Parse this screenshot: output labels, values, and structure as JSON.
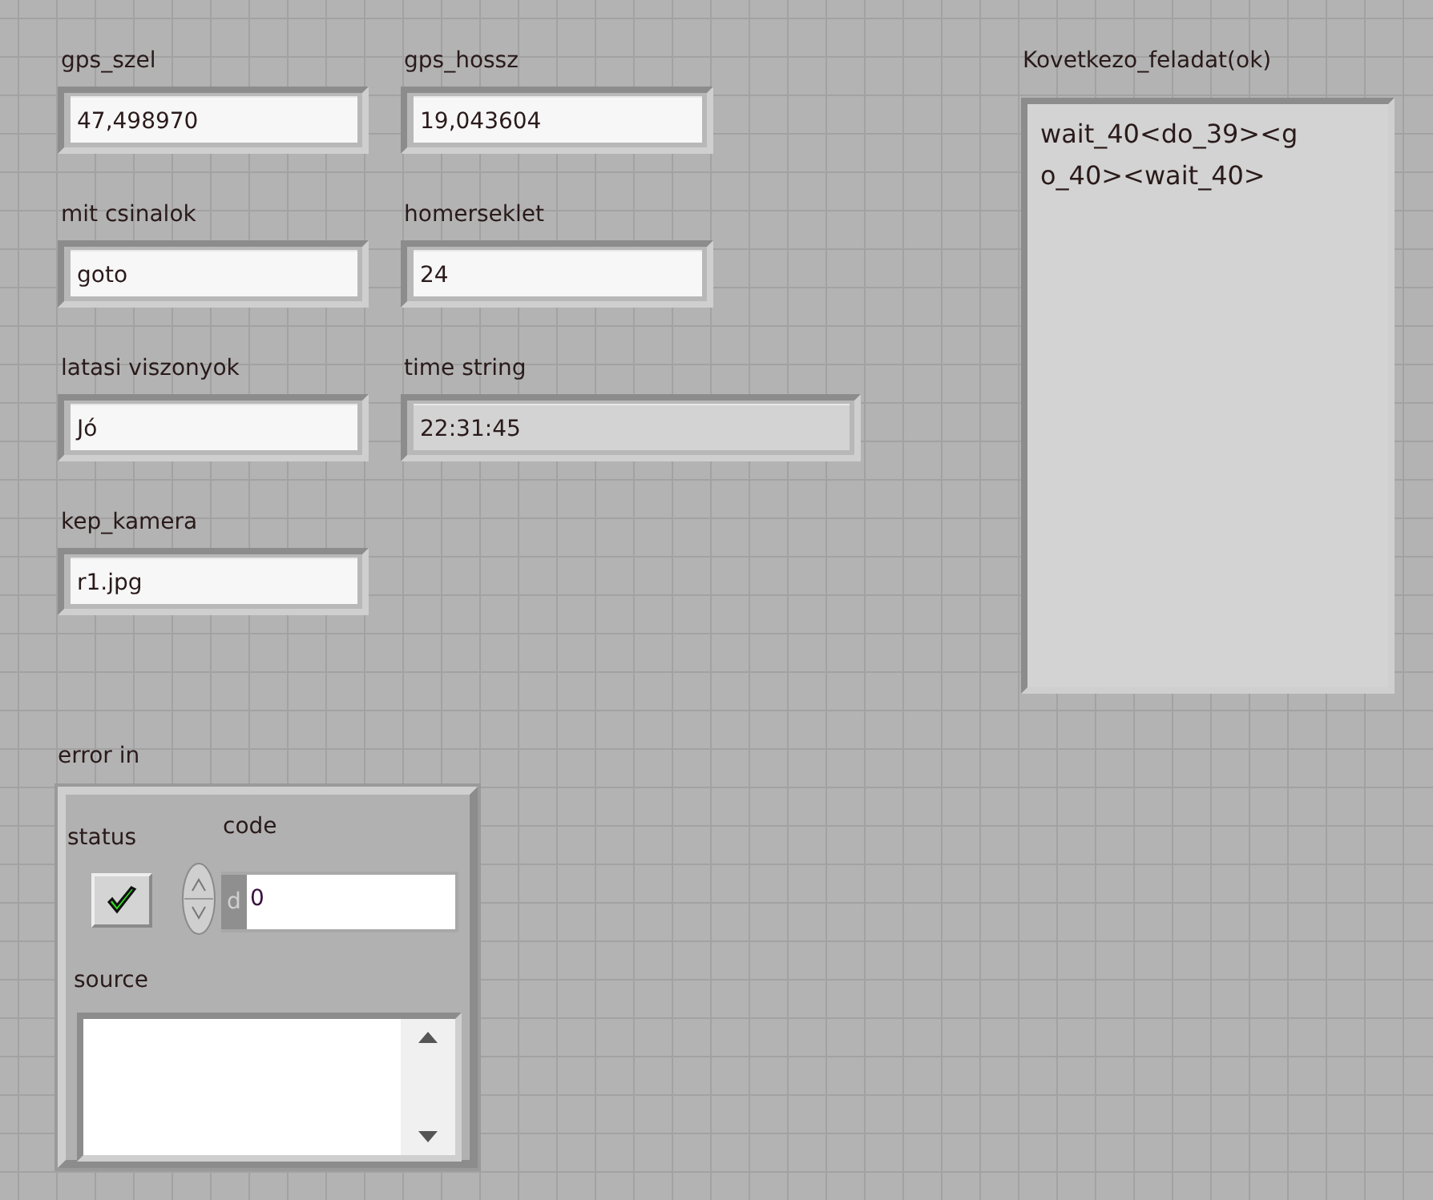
{
  "fields": [
    {
      "label": "gps_szel",
      "value": "47,498970",
      "kind": "control"
    },
    {
      "label": "gps_hossz",
      "value": "19,043604",
      "kind": "control"
    },
    {
      "label": "mit csinalok",
      "value": "goto",
      "kind": "control"
    },
    {
      "label": "homerseklet",
      "value": "24",
      "kind": "control"
    },
    {
      "label": "latasi viszonyok",
      "value": "Jó",
      "kind": "control"
    },
    {
      "label": "time string",
      "value": "22:31:45",
      "kind": "indicator"
    },
    {
      "label": "kep_kamera",
      "value": "r1.jpg",
      "kind": "control"
    }
  ],
  "next_tasks": {
    "label": "Kovetkezo_feladat(ok)",
    "text": "wait_40<do_39><go_40><wait_40>"
  },
  "error_in": {
    "label": "error in",
    "status": {
      "label": "status",
      "checked": true
    },
    "code": {
      "label": "code",
      "radix": "d",
      "value": "0"
    },
    "source": {
      "label": "source"
    }
  }
}
